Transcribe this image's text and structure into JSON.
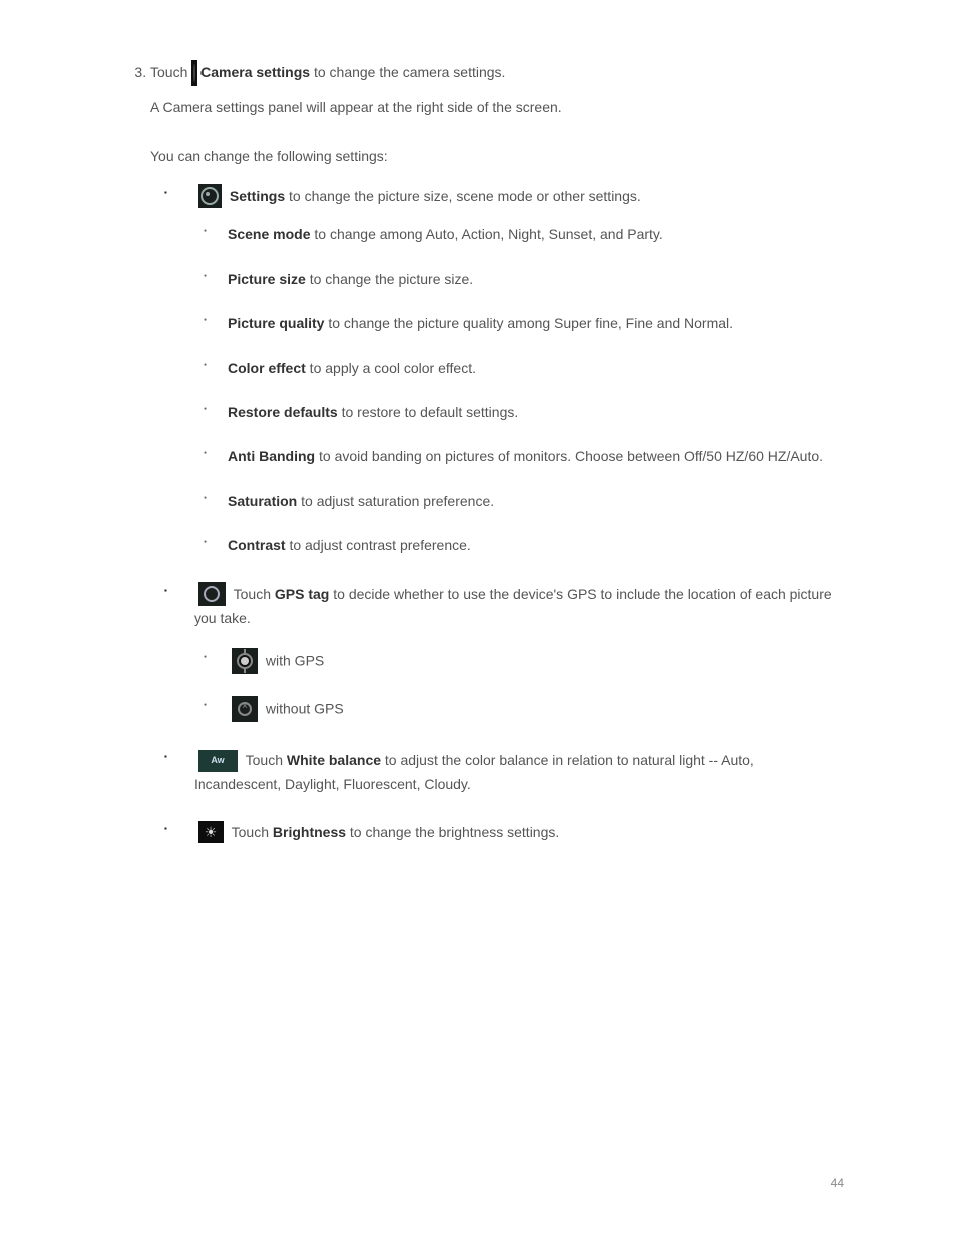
{
  "step3_prefix": "Touch",
  "step3_label": "Camera settings",
  "step3_suffix": " to change the camera settings.",
  "step3_note": "A Camera settings panel will appear at the right side of the screen.",
  "settings_intro": "You can change the following settings:",
  "bullets": {
    "settings_label": "Settings",
    "settings_text": " to change the picture size, scene mode or other settings.",
    "sub": [
      {
        "label": "Scene mode",
        "text": " to change among Auto, Action, Night, Sunset, and Party."
      },
      {
        "label": "Picture size",
        "text": " to change the picture size."
      },
      {
        "label": "Picture quality",
        "text": " to change the picture quality among Super fine, Fine and Normal."
      },
      {
        "label": "Color effect",
        "text": " to apply a cool color effect."
      },
      {
        "label": "Restore defaults",
        "text": " to restore to default settings."
      },
      {
        "label": "Anti Banding",
        "text": " to avoid banding on pictures of monitors. Choose between Off/50 HZ/60 HZ/Auto."
      },
      {
        "label": "Saturation",
        "text": " to adjust saturation preference."
      },
      {
        "label": "Contrast",
        "text": " to adjust contrast preference."
      }
    ],
    "gps_label_pre": " Touch ",
    "gps_label_bold": "GPS tag",
    "gps_label_after": " to decide whether to use the device's GPS to include the location of each picture you take.",
    "gps_on_label": " with GPS",
    "gps_off_label": " without GPS",
    "wb_pre": "Touch ",
    "wb_bold": "White balance",
    "wb_text": " to adjust the color balance in relation to natural light -- Auto, Incandescent, Daylight, Fluorescent, Cloudy.",
    "bright_pre": "Touch ",
    "bright_bold": "Brightness",
    "bright_text": " to change the brightness settings."
  },
  "page_number": "44"
}
